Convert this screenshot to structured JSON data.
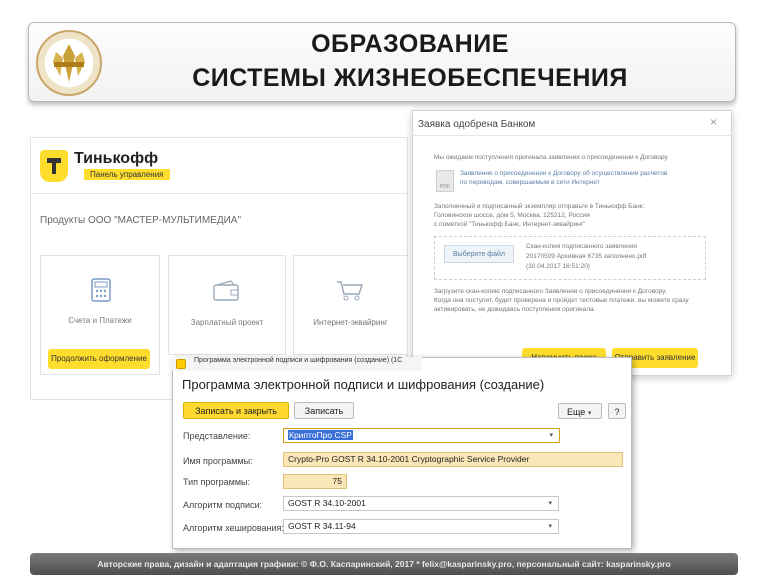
{
  "slide": {
    "title_line1": "ОБРАЗОВАНИЕ",
    "title_line2": "СИСТЕМЫ ЖИЗНЕОБЕСПЕЧЕНИЯ",
    "footer": "Авторские права, дизайн и адаптация графики: © Ф.О. Каспаринский, 2017 * felix@kasparinsky.pro, персональный сайт: kasparinsky.pro"
  },
  "tinkoff": {
    "brand": "Тинькофф",
    "badge": "Панель управления",
    "products_title": "Продукты ООО \"МАСТЕР-МУЛЬТИМЕДИА\"",
    "cards": [
      {
        "label": "Счета и Платежи",
        "icon": "calculator-icon"
      },
      {
        "label": "Зарплатный проект",
        "icon": "wallet-icon"
      },
      {
        "label": "Интернет-эквайринг",
        "icon": "cart-icon"
      }
    ],
    "apply_button": "Продолжить оформление"
  },
  "modal": {
    "title": "Заявка одобрена Банком",
    "close": "×",
    "line1": "Мы ожидаем поступления оригинала заявления о присоединении к Договору",
    "link1": "Заявление о присоединении к Договору об осуществлении расчетов",
    "link2": "по переводам, совершаемым в сети Интернет",
    "pdf": "PDF",
    "addr1": "Заполненный и подписанный экземпляр отправьте в Тинькофф Банк:",
    "addr2": "Головинское шоссе, дом 5, Москва, 125212, Россия",
    "addr3": "с пометкой \"Тинькофф Банк, Интернет-эквайринг\"",
    "choose_file": "Выберите файл",
    "scan1": "Скан-копия подписанного заявления",
    "scan2": "20170509 Архивная 6735 заполнено.pdf",
    "scan3": "(30.04.2017 16:51:20)",
    "note1": "Загрузите скан-копию подписанного Заявления о присоединении к Договору.",
    "note2": "Когда она поступит, будет проверена и пройдет тестовые платежи, вы можете сразу",
    "note3": "активировать, не дожидаясь поступления оригинала.",
    "remind_button": "Напомнить позже",
    "send_button": "Отправить заявление"
  },
  "program": {
    "window_title": "Программа электронной подписи и шифрования (создание) (1С",
    "heading": "Программа электронной подписи и шифрования (создание)",
    "save_close": "Записать и закрыть",
    "save": "Записать",
    "more": "Еще",
    "help": "?",
    "fields": [
      {
        "label": "Представление:",
        "value": "КриптоПро CSP"
      },
      {
        "label": "Имя программы:",
        "value": "Crypto-Pro GOST R 34.10-2001 Cryptographic Service Provider"
      },
      {
        "label": "Тип программы:",
        "value": "75"
      },
      {
        "label": "Алгоритм подписи:",
        "value": "GOST R 34.10-2001"
      },
      {
        "label": "Алгоритм хеширования:",
        "value": "GOST R 34.11-94"
      }
    ]
  },
  "colors": {
    "tinkoff_yellow": "#ffdd2d",
    "footer_bg": "#5a5a5a",
    "field_yellow": "#fbe6b7"
  }
}
